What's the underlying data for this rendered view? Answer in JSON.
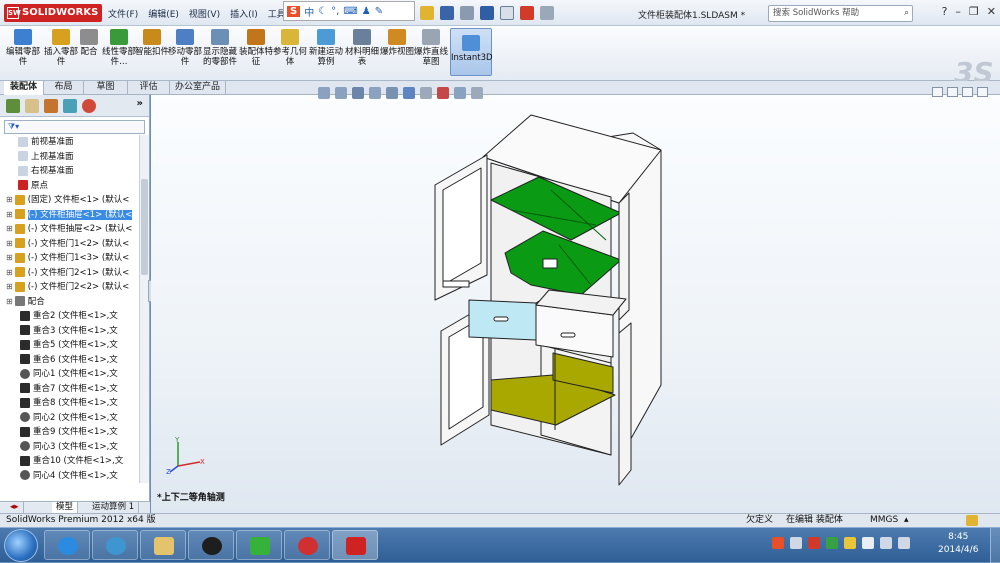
{
  "app": {
    "title": "SOLIDWORKS",
    "document_title": "文件柜装配体1.SLDASM *"
  },
  "menu": [
    "文件(F)",
    "编辑(E)",
    "视图(V)",
    "插入(I)",
    "工具"
  ],
  "ime": {
    "label": "中"
  },
  "help_search": {
    "placeholder": "搜索 SolidWorks 帮助"
  },
  "commands": [
    {
      "label": "编辑零部件",
      "color": "#3d7fd0"
    },
    {
      "label": "插入零部件",
      "color": "#d6a11e"
    },
    {
      "label": "配合",
      "color": "#8d8d8d"
    },
    {
      "label": "线性零部件…",
      "color": "#3a9a3a"
    },
    {
      "label": "智能扣件",
      "color": "#c88a1a"
    },
    {
      "label": "移动零部件",
      "color": "#4e7ec4"
    },
    {
      "label": "显示隐藏的零部件",
      "color": "#6b8fb5"
    },
    {
      "label": "装配体特征",
      "color": "#c2761b"
    },
    {
      "label": "参考几何体",
      "color": "#d9b63a"
    },
    {
      "label": "新建运动算例",
      "color": "#4c9bd4"
    },
    {
      "label": "材料明细表",
      "color": "#6a7f9a"
    },
    {
      "label": "爆炸视图",
      "color": "#cf8a22"
    },
    {
      "label": "爆炸直线草图",
      "color": "#9aa5b3"
    },
    {
      "label": "Instant3D",
      "color": "#4f8fd8"
    }
  ],
  "command_tabs": [
    "装配体",
    "布局",
    "草图",
    "评估",
    "办公室产品"
  ],
  "tree": [
    {
      "label": "前视基准面",
      "icon": "plane"
    },
    {
      "label": "上视基准面",
      "icon": "plane"
    },
    {
      "label": "右视基准面",
      "icon": "plane"
    },
    {
      "label": "原点",
      "icon": "origin"
    },
    {
      "label": "(固定) 文件柜<1> (默认<",
      "icon": "part"
    },
    {
      "label": "(-) 文件柜抽屉<1> (默认<",
      "icon": "part",
      "selected": true
    },
    {
      "label": "(-) 文件柜抽屉<2> (默认<",
      "icon": "part"
    },
    {
      "label": "(-) 文件柜门1<2> (默认<",
      "icon": "part"
    },
    {
      "label": "(-) 文件柜门1<3> (默认<",
      "icon": "part"
    },
    {
      "label": "(-) 文件柜门2<1> (默认<",
      "icon": "part"
    },
    {
      "label": "(-) 文件柜门2<2> (默认<",
      "icon": "part"
    },
    {
      "label": "配合",
      "icon": "mates"
    },
    {
      "label": "重合2 (文件柜<1>,文",
      "icon": "coincident"
    },
    {
      "label": "重合3 (文件柜<1>,文",
      "icon": "coincident"
    },
    {
      "label": "重合5 (文件柜<1>,文",
      "icon": "coincident"
    },
    {
      "label": "重合6 (文件柜<1>,文",
      "icon": "coincident"
    },
    {
      "label": "同心1 (文件柜<1>,文",
      "icon": "concentric"
    },
    {
      "label": "重合7 (文件柜<1>,文",
      "icon": "coincident"
    },
    {
      "label": "重合8 (文件柜<1>,文",
      "icon": "coincident"
    },
    {
      "label": "同心2 (文件柜<1>,文",
      "icon": "concentric"
    },
    {
      "label": "重合9 (文件柜<1>,文",
      "icon": "coincident"
    },
    {
      "label": "同心3 (文件柜<1>,文",
      "icon": "concentric"
    },
    {
      "label": "重合10 (文件柜<1>,文",
      "icon": "coincident"
    },
    {
      "label": "同心4 (文件柜<1>,文",
      "icon": "concentric"
    }
  ],
  "bottom_tabs": [
    "模型",
    "运动算例 1"
  ],
  "graphics": {
    "orientation_label": "*上下二等角轴测"
  },
  "triad": {
    "x": "X",
    "y": "Y",
    "z": "Z"
  },
  "statusbar": {
    "version": "SolidWorks Premium 2012 x64 版",
    "state": "欠定义",
    "mode": "在编辑 装配体",
    "units": "MMGS"
  },
  "clock": {
    "time": "8:45",
    "date": "2014/4/6"
  },
  "colors": {
    "shelf_green": "#0a9a14",
    "bottom_olive": "#a8a800",
    "drawer_highlight": "#bfe8f5",
    "selection_blue": "#3a8be3"
  }
}
